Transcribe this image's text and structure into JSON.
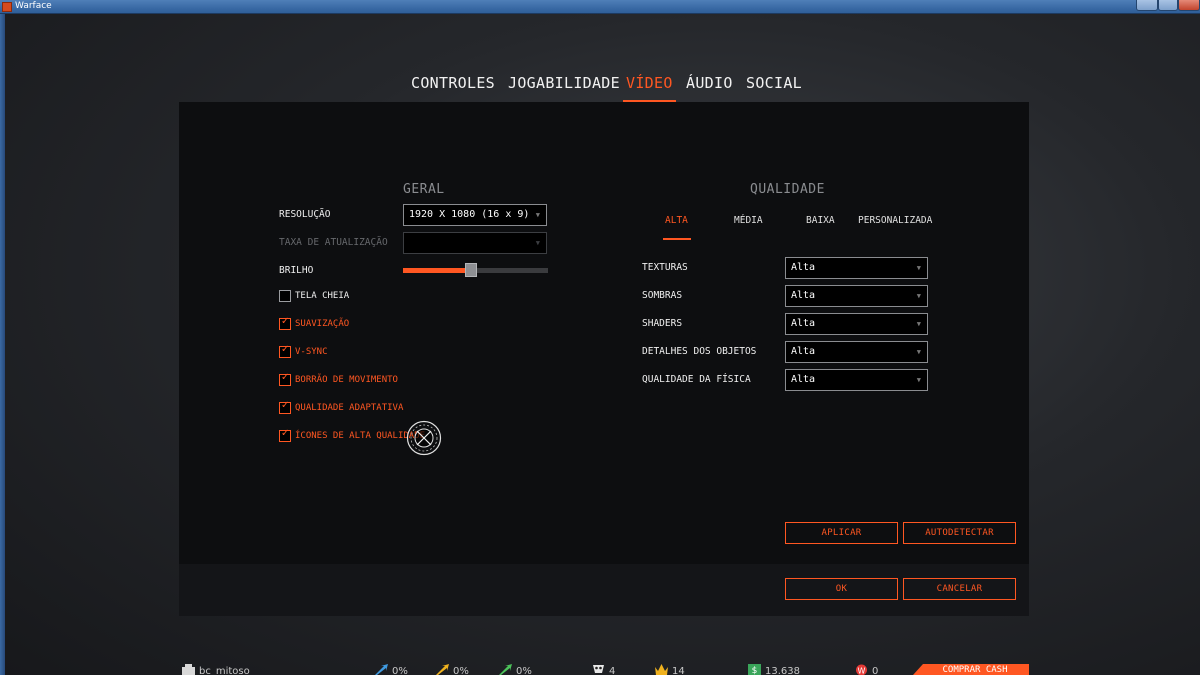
{
  "window": {
    "title": "Warface",
    "subtitle": ""
  },
  "tabs": [
    {
      "label": "CONTROLES",
      "active": false
    },
    {
      "label": "JOGABILIDADE",
      "active": false
    },
    {
      "label": "VÍDEO",
      "active": true
    },
    {
      "label": "ÁUDIO",
      "active": false
    },
    {
      "label": "SOCIAL",
      "active": false
    }
  ],
  "general": {
    "title": "GERAL",
    "resolution": {
      "label": "RESOLUÇÃO",
      "value": "1920 X 1080 (16 x 9)"
    },
    "refresh_rate": {
      "label": "TAXA DE ATUALIZAÇÃO",
      "value": ""
    },
    "brightness": {
      "label": "BRILHO",
      "level": 0.47
    },
    "checkboxes": [
      {
        "label": "TELA CHEIA",
        "checked": false
      },
      {
        "label": "SUAVIZAÇÃO",
        "checked": true
      },
      {
        "label": "V-SYNC",
        "checked": true
      },
      {
        "label": "BORRÃO DE MOVIMENTO",
        "checked": true
      },
      {
        "label": "QUALIDADE ADAPTATIVA",
        "checked": true
      },
      {
        "label": "ÍCONES DE ALTA QUALIDADE",
        "checked": true
      }
    ]
  },
  "quality": {
    "title": "QUALIDADE",
    "presets": [
      {
        "label": "ALTA",
        "active": true
      },
      {
        "label": "MÉDIA",
        "active": false
      },
      {
        "label": "BAIXA",
        "active": false
      },
      {
        "label": "PERSONALIZADA",
        "active": false
      }
    ],
    "settings": [
      {
        "label": "TEXTURAS",
        "value": "Alta"
      },
      {
        "label": "SOMBRAS",
        "value": "Alta"
      },
      {
        "label": "SHADERS",
        "value": "Alta"
      },
      {
        "label": "DETALHES DOS OBJETOS",
        "value": "Alta"
      },
      {
        "label": "QUALIDADE DA FÍSICA",
        "value": "Alta"
      }
    ]
  },
  "buttons": {
    "apply": "APLICAR",
    "autodetect": "AUTODETECTAR",
    "ok": "OK",
    "cancel": "CANCELAR"
  },
  "status": {
    "player": "bc_mitoso",
    "stat1": "0%",
    "stat2": "0%",
    "stat3": "0%",
    "stat4": "4",
    "stat5": "14",
    "money": "13.638",
    "wcoins": "0",
    "buy_cash": "COMPRAR CASH"
  },
  "colors": {
    "accent": "#ff5722",
    "panel": "#0d0e10"
  },
  "icons": [
    "dropdown-arrow-icon",
    "check-icon",
    "cursor-ring-icon",
    "rank-icon",
    "arrow-up-icon",
    "skull-icon",
    "crown-icon",
    "dollar-icon",
    "w-coin-icon"
  ]
}
